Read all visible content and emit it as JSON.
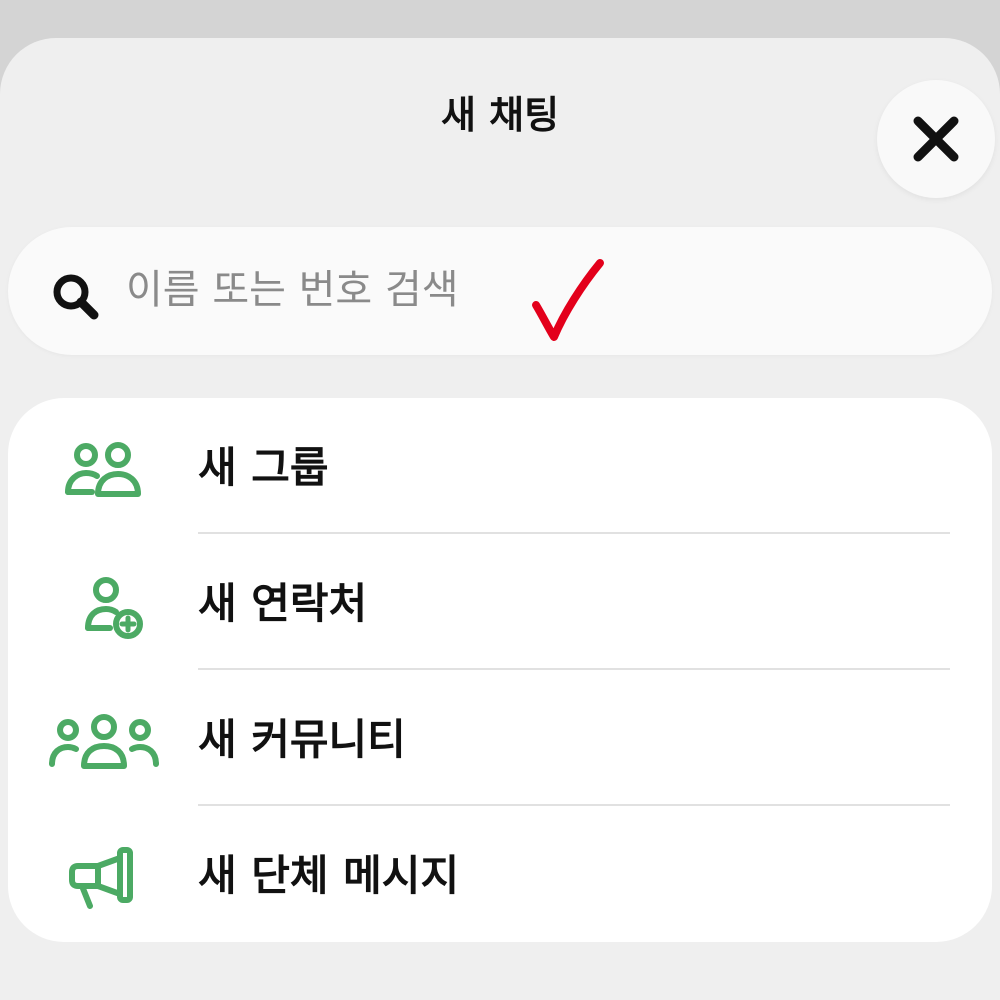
{
  "header": {
    "title": "새 채팅",
    "close_icon": "close-icon"
  },
  "search": {
    "placeholder": "이름 또는 번호 검색",
    "icon": "search-icon",
    "annotation_icon": "red-checkmark-icon"
  },
  "menu": {
    "items": [
      {
        "label": "새 그룹",
        "icon": "group-icon"
      },
      {
        "label": "새 연락처",
        "icon": "add-contact-icon"
      },
      {
        "label": "새 커뮤니티",
        "icon": "community-icon"
      },
      {
        "label": "새 단체 메시지",
        "icon": "megaphone-icon"
      }
    ]
  },
  "colors": {
    "accent": "#4caa64",
    "annotation": "#e3001b",
    "text": "#111111",
    "placeholder": "#8a8a8a"
  }
}
